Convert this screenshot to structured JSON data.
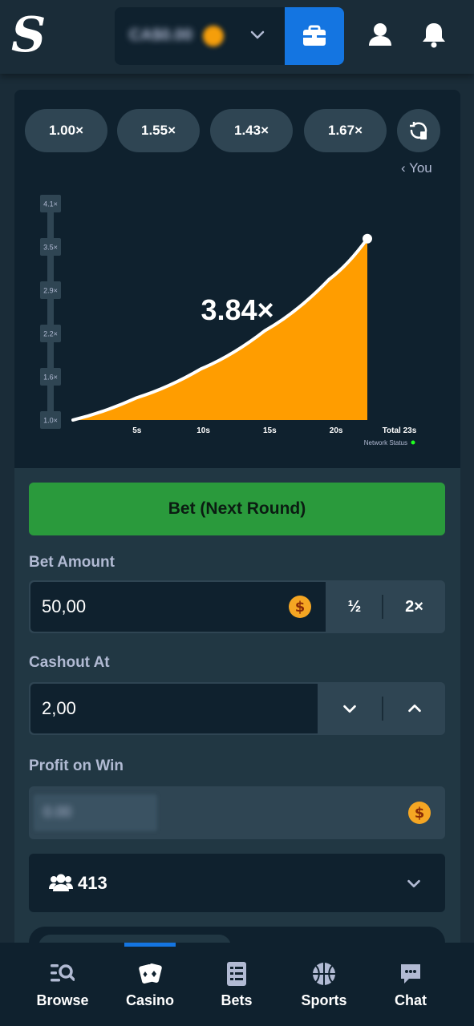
{
  "header": {
    "balance": "CA$0.00",
    "icons": [
      "stake-logo-icon",
      "chevron-down-icon",
      "wallet-icon",
      "user-icon",
      "bell-icon"
    ]
  },
  "game": {
    "history": [
      "1.00×",
      "1.55×",
      "1.43×",
      "1.67×"
    ],
    "you_label": "‹ You",
    "multiplier": "3.84×",
    "network_status": "Network Status",
    "network_color": "#1fff20"
  },
  "chart_data": {
    "type": "area",
    "y_ticks": [
      "4.1×",
      "3.5×",
      "2.9×",
      "2.2×",
      "1.6×",
      "1.0×"
    ],
    "x_ticks": [
      "5s",
      "10s",
      "15s",
      "20s",
      "Total 23s"
    ],
    "x": [
      0,
      5,
      10,
      15,
      20,
      23
    ],
    "y": [
      1.0,
      1.35,
      1.8,
      2.4,
      3.2,
      3.84
    ],
    "ylim": [
      1.0,
      4.1
    ],
    "fill_color": "#ff9d00"
  },
  "controls": {
    "bet_button": "Bet (Next Round)",
    "bet_amount_label": "Bet Amount",
    "bet_amount_value": "50,00",
    "half_label": "½",
    "double_label": "2×",
    "cashout_label": "Cashout At",
    "cashout_value": "2,00",
    "profit_label": "Profit on Win",
    "profit_value": "0.00",
    "currency_symbol": "$",
    "players_count": "413"
  },
  "nav": {
    "items": [
      {
        "label": "Browse",
        "icon": "browse-icon"
      },
      {
        "label": "Casino",
        "icon": "casino-icon"
      },
      {
        "label": "Bets",
        "icon": "bets-icon"
      },
      {
        "label": "Sports",
        "icon": "sports-icon"
      },
      {
        "label": "Chat",
        "icon": "chat-icon"
      }
    ],
    "active": "Casino",
    "accent": "#1475e1"
  }
}
